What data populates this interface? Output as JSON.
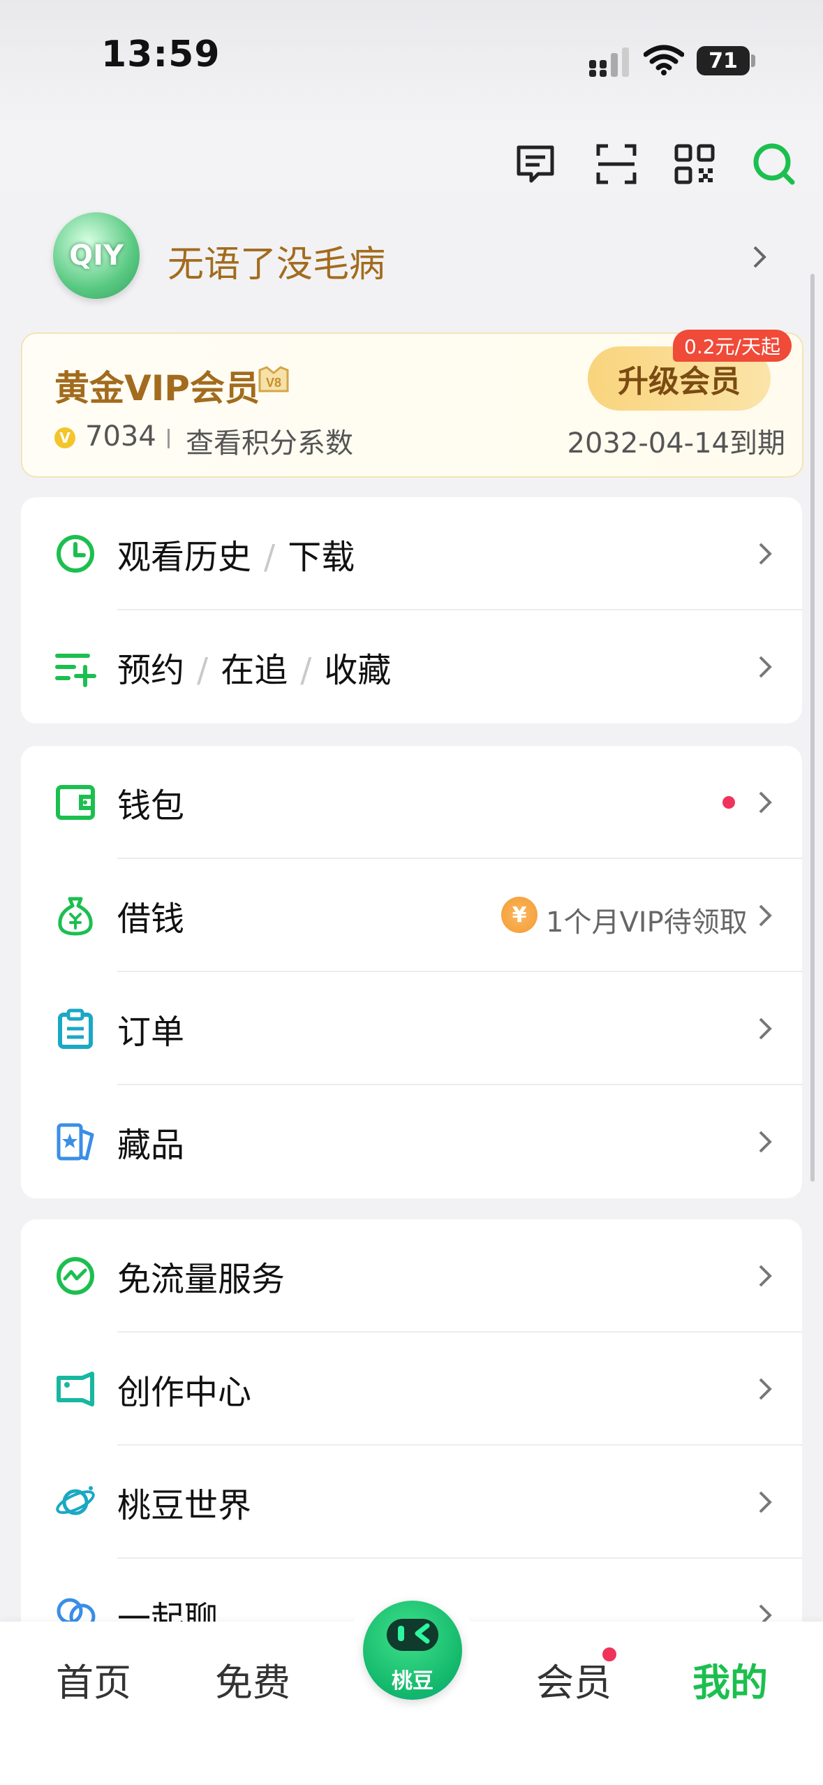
{
  "status_bar": {
    "time": "13:59",
    "battery": "71"
  },
  "toolbar": {
    "icons": [
      "message-icon",
      "scan-icon",
      "qr-code-icon",
      "search-icon"
    ]
  },
  "profile": {
    "avatar_text": "QIY",
    "username": "无语了没毛病"
  },
  "vip": {
    "title": "黄金VIP会员",
    "points": "7034",
    "points_link": "查看积分系数",
    "expiry": "2032-04-14到期",
    "upgrade_label": "升级会员",
    "price_badge": "0.2元/天起"
  },
  "section1": [
    {
      "icon": "clock-icon",
      "parts": [
        "观看历史",
        "下载"
      ]
    },
    {
      "icon": "list-add-icon",
      "parts": [
        "预约",
        "在追",
        "收藏"
      ]
    }
  ],
  "section2": [
    {
      "icon": "wallet-icon",
      "label": "钱包",
      "badge": "red-dot"
    },
    {
      "icon": "money-bag-icon",
      "label": "借钱",
      "hint": "1个月VIP待领取",
      "hint_icon": "yuan-coin-icon"
    },
    {
      "icon": "clipboard-icon",
      "label": "订单"
    },
    {
      "icon": "collectible-icon",
      "label": "藏品"
    }
  ],
  "section3": [
    {
      "icon": "wave-circle-icon",
      "label": "免流量服务"
    },
    {
      "icon": "camera-icon",
      "label": "创作中心"
    },
    {
      "icon": "planet-icon",
      "label": "桃豆世界"
    },
    {
      "icon": "chat-bubbles-icon",
      "label": "一起聊"
    }
  ],
  "tabbar": {
    "home": "首页",
    "free": "免费",
    "center": "桃豆",
    "vip": "会员",
    "mine": "我的",
    "active": "我的"
  },
  "colors": {
    "accent": "#1cbf4f",
    "gold": "#a26b1d",
    "badge_red": "#f04a38"
  }
}
